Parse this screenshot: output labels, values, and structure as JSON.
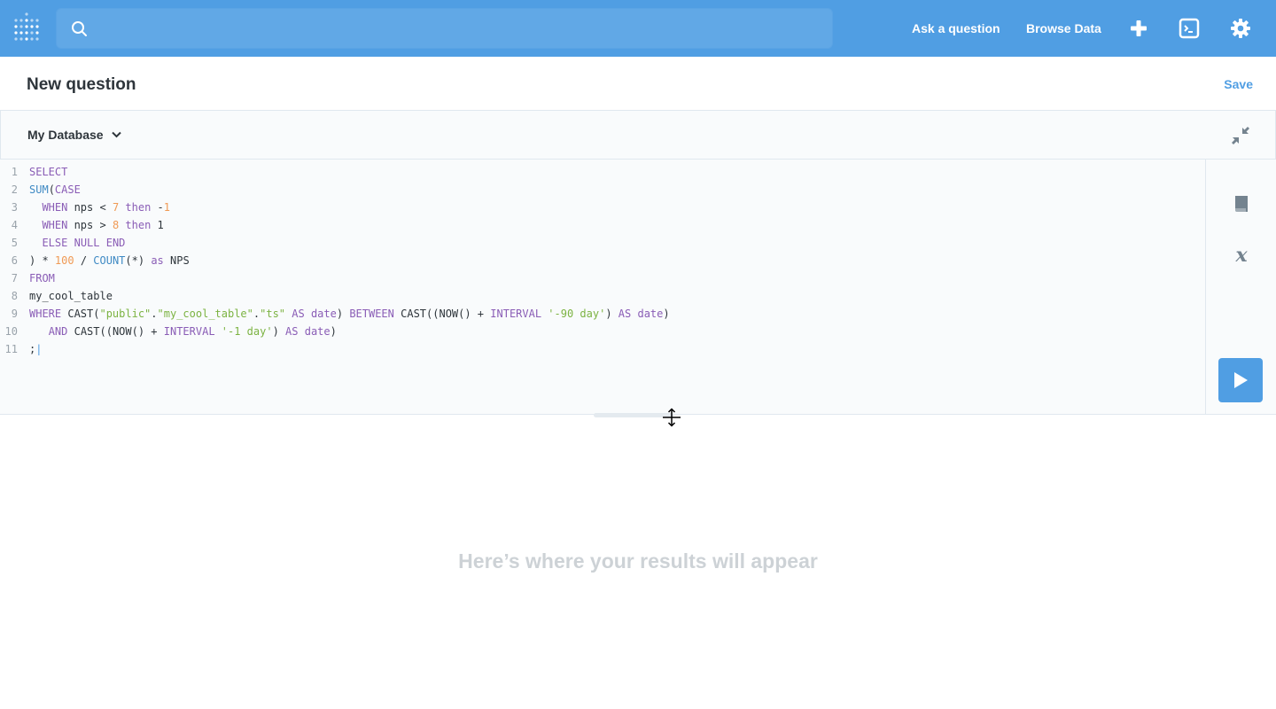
{
  "nav": {
    "logo_icon": "metabase-logo-icon",
    "search_placeholder": "",
    "ask_question": "Ask a question",
    "browse_data": "Browse Data",
    "icons": [
      "plus-icon",
      "sql-terminal-icon",
      "gear-icon"
    ]
  },
  "header": {
    "title": "New question",
    "save_label": "Save"
  },
  "database": {
    "selected": "My Database"
  },
  "editor": {
    "line_numbers": [
      "1",
      "2",
      "3",
      "4",
      "5",
      "6",
      "7",
      "8",
      "9",
      "10",
      "11"
    ],
    "query": "SELECT\nSUM(CASE\n  WHEN nps < 7 then -1\n  WHEN nps > 8 then 1\n  ELSE NULL END\n) * 100 / COUNT(*) as NPS\nFROM\nmy_cool_table\nWHERE CAST(\"public\".\"my_cool_table\".\"ts\" AS date) BETWEEN CAST((NOW() + INTERVAL '-90 day') AS date)\n   AND CAST((NOW() + INTERVAL '-1 day') AS date)\n;"
  },
  "sidebar": {
    "icons": [
      "data-reference-icon",
      "variables-icon",
      "run-icon"
    ]
  },
  "results": {
    "placeholder": "Here’s where your results will appear"
  },
  "colors": {
    "brand": "#509ee3",
    "keyword": "#8a5db6",
    "function": "#3f8ac4",
    "number": "#f09a55",
    "string": "#7cb342"
  }
}
